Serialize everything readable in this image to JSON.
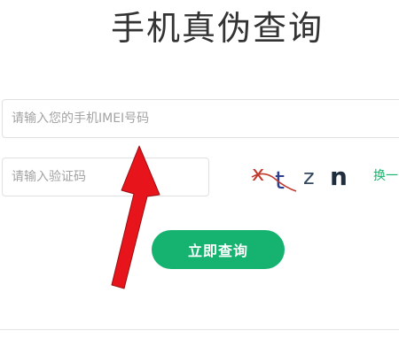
{
  "page": {
    "title": "手机真伪查询"
  },
  "form": {
    "imei_placeholder": "请输入您的手机IMEI号码",
    "imei_value": "",
    "captcha_placeholder": "请输入验证码",
    "captcha_value": "",
    "captcha_text": [
      "x",
      "t",
      "z",
      "n"
    ],
    "refresh_label": "换一张",
    "submit_label": "立即查询"
  },
  "colors": {
    "accent": "#16b370",
    "link": "#15b36d",
    "annotation_arrow": "#e8141b"
  },
  "annotation": {
    "arrow-icon": "red-arrow-pointing-to-imei-input"
  }
}
